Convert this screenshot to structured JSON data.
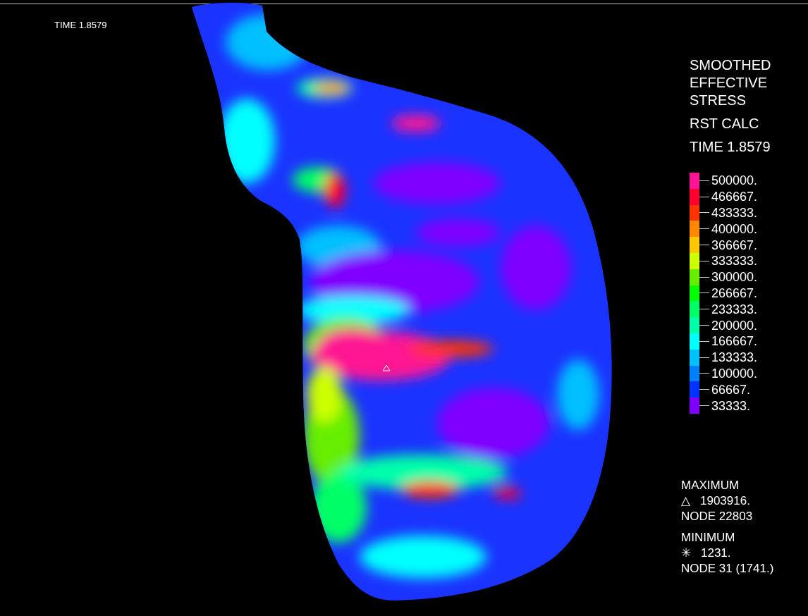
{
  "time_label": "TIME 1.8579",
  "legend": {
    "title_lines": [
      "SMOOTHED",
      "EFFECTIVE",
      "STRESS"
    ],
    "subtitle": "RST CALC",
    "time": "TIME 1.8579",
    "levels": [
      {
        "label": "500000.",
        "color": "#ff1493"
      },
      {
        "label": "466667.",
        "color": "#ff0030"
      },
      {
        "label": "433333.",
        "color": "#ff3300"
      },
      {
        "label": "400000.",
        "color": "#ff8800"
      },
      {
        "label": "366667.",
        "color": "#ffc800"
      },
      {
        "label": "333333.",
        "color": "#ccff00"
      },
      {
        "label": "300000.",
        "color": "#66ee00"
      },
      {
        "label": "266667.",
        "color": "#00ff00"
      },
      {
        "label": "233333.",
        "color": "#00ff66"
      },
      {
        "label": "200000.",
        "color": "#00ffaa"
      },
      {
        "label": "166667.",
        "color": "#00ffff"
      },
      {
        "label": "133333.",
        "color": "#00c0ff"
      },
      {
        "label": "100000.",
        "color": "#0080ff"
      },
      {
        "label": "66667.",
        "color": "#0033ff"
      },
      {
        "label": "33333.",
        "color": "#8000ff"
      }
    ]
  },
  "maximum": {
    "heading": "MAXIMUM",
    "symbol": "△",
    "value": "1903916.",
    "node": "NODE 22803"
  },
  "minimum": {
    "heading": "MINIMUM",
    "symbol": "✳",
    "value": "1231.",
    "node": "NODE 31 (1741.)"
  }
}
